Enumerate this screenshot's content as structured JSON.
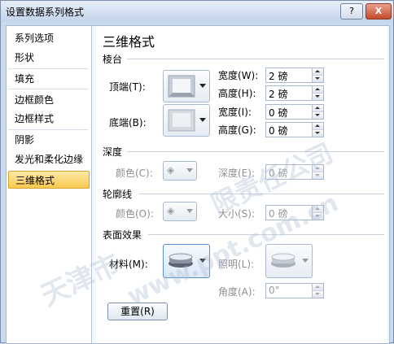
{
  "window": {
    "title": "设置数据系列格式",
    "help_label": "?",
    "close_label": "X"
  },
  "nav": {
    "items": [
      {
        "label": "系列选项"
      },
      {
        "label": "形状"
      },
      {
        "label": "填充"
      },
      {
        "label": "边框颜色"
      },
      {
        "label": "边框样式"
      },
      {
        "label": "阴影"
      },
      {
        "label": "发光和柔化边缘"
      },
      {
        "label": "三维格式"
      }
    ],
    "selected": "三维格式"
  },
  "panel": {
    "heading": "三维格式",
    "bevel": {
      "section": "棱台",
      "top_label": "顶端(T):",
      "bottom_label": "底端(B):",
      "top_width_label": "宽度(W):",
      "top_width_value": "2 磅",
      "top_height_label": "高度(H):",
      "top_height_value": "2 磅",
      "bottom_width_label": "宽度(I):",
      "bottom_width_value": "0 磅",
      "bottom_height_label": "高度(G):",
      "bottom_height_value": "0 磅"
    },
    "depth": {
      "section": "深度",
      "color_label": "颜色(C):",
      "depth_label": "深度(E):",
      "depth_value": "0 磅"
    },
    "contour": {
      "section": "轮廓线",
      "color_label": "颜色(O):",
      "size_label": "大小(S):",
      "size_value": "0 磅"
    },
    "surface": {
      "section": "表面效果",
      "material_label": "材料(M):",
      "lighting_label": "照明(L):",
      "angle_label": "角度(A):",
      "angle_value": "0°"
    },
    "reset_label": "重置(R)"
  },
  "watermarks": [
    "天津市",
    "www.ppt.com.cn",
    "限责任公司"
  ],
  "colors": {
    "accent": "#f8c94f",
    "window_frame": "#c9d9ee"
  }
}
